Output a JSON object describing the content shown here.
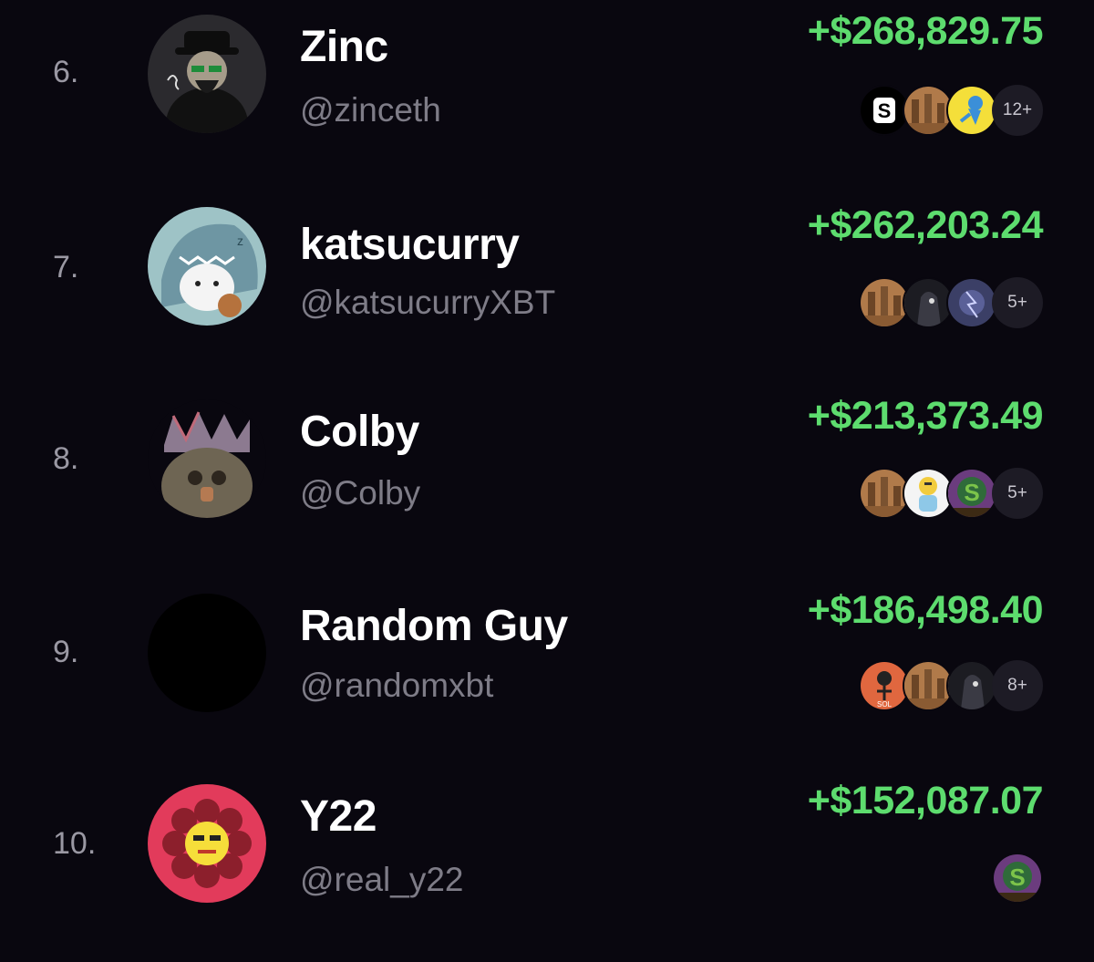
{
  "colors": {
    "background": "#09070f",
    "profit": "#5ddc6e",
    "rank": "#9a98a3",
    "name": "#ffffff",
    "handle": "#7e7c87",
    "more_badge_bg": "#1d1b25"
  },
  "rows": [
    {
      "rank": "6.",
      "name": "Zinc",
      "handle": "@zinceth",
      "pnl": "+$268,829.75",
      "avatar_icon": "hooded-figure-avatar-icon",
      "tokens": [
        "s-logo-token-icon",
        "ruins-token-icon",
        "blue-creature-token-icon"
      ],
      "more": "12+"
    },
    {
      "rank": "7.",
      "name": "katsucurry",
      "handle": "@katsucurryXBT",
      "pnl": "+$262,203.24",
      "avatar_icon": "shark-cat-avatar-icon",
      "tokens": [
        "ruins-token-icon",
        "dark-figure-token-icon",
        "storm-token-icon"
      ],
      "more": "5+"
    },
    {
      "rank": "8.",
      "name": "Colby",
      "handle": "@Colby",
      "pnl": "+$213,373.49",
      "avatar_icon": "crowned-creature-avatar-icon",
      "tokens": [
        "ruins-token-icon",
        "cartoon-character-token-icon",
        "popcat-s-token-icon"
      ],
      "more": "5+"
    },
    {
      "rank": "9.",
      "name": "Random Guy",
      "handle": "@randomxbt",
      "pnl": "+$186,498.40",
      "avatar_icon": "blank-avatar-icon",
      "tokens": [
        "sol-skeleton-token-icon",
        "ruins-token-icon",
        "dark-figure-token-icon"
      ],
      "more": "8+"
    },
    {
      "rank": "10.",
      "name": "Y22",
      "handle": "@real_y22",
      "pnl": "+$152,087.07",
      "avatar_icon": "pixel-flower-avatar-icon",
      "tokens": [
        "popcat-s-token-icon"
      ],
      "more": ""
    }
  ]
}
